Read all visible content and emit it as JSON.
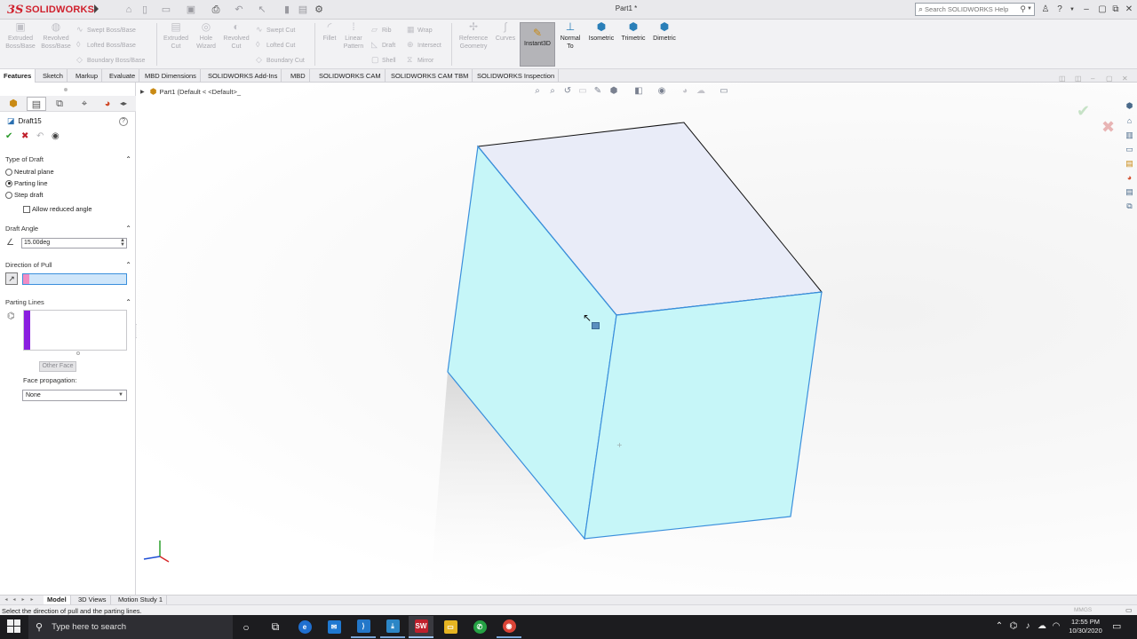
{
  "app": {
    "logo_ds": "3S",
    "logo_name": "SOLIDWORKS",
    "document_title": "Part1 *",
    "search_placeholder": "Search SOLIDWORKS Help"
  },
  "ribbon": {
    "tools_left": [
      {
        "label": "Extruded Boss/Base",
        "line1": "Extruded",
        "line2": "Boss/Base"
      },
      {
        "label": "Revolved Boss/Base",
        "line1": "Revolved",
        "line2": "Boss/Base"
      }
    ],
    "boss_small": [
      "Swept Boss/Base",
      "Lofted Boss/Base",
      "Boundary Boss/Base"
    ],
    "cut_tools": [
      {
        "line1": "Extruded",
        "line2": "Cut"
      },
      {
        "line1": "Hole",
        "line2": "Wizard"
      },
      {
        "line1": "Revolved",
        "line2": "Cut"
      }
    ],
    "cut_small": [
      "Swept Cut",
      "Lofted Cut",
      "Boundary Cut"
    ],
    "fillet": "Fillet",
    "linear_pattern": {
      "line1": "Linear",
      "line2": "Pattern"
    },
    "feature_small": [
      "Rib",
      "Draft",
      "Shell"
    ],
    "feature_small2": [
      "Wrap",
      "Intersect",
      "Mirror"
    ],
    "reference_geometry": {
      "line1": "Reference",
      "line2": "Geometry"
    },
    "curves": "Curves",
    "instant3d": "Instant3D",
    "views": [
      {
        "line1": "Normal",
        "line2": "To"
      },
      {
        "line1": "Isometric",
        "line2": ""
      },
      {
        "line1": "Trimetric",
        "line2": ""
      },
      {
        "line1": "Dimetric",
        "line2": ""
      }
    ]
  },
  "tabs": [
    "Features",
    "Sketch",
    "Markup",
    "Evaluate",
    "MBD Dimensions",
    "SOLIDWORKS Add-Ins",
    "MBD",
    "SOLIDWORKS CAM",
    "SOLIDWORKS CAM TBM",
    "SOLIDWORKS Inspection"
  ],
  "property_manager": {
    "title": "Draft15",
    "type_of_draft": {
      "heading": "Type of Draft",
      "options": [
        "Neutral plane",
        "Parting line",
        "Step draft"
      ],
      "selected": "Parting line",
      "allow_reduced": "Allow reduced angle"
    },
    "draft_angle": {
      "heading": "Draft Angle",
      "value": "15.00deg"
    },
    "direction_of_pull": {
      "heading": "Direction of Pull"
    },
    "parting_lines": {
      "heading": "Parting Lines",
      "other_face": "Other Face"
    },
    "face_propagation": {
      "label": "Face propagation:",
      "value": "None"
    }
  },
  "viewport": {
    "tree_path": "Part1  (Default < <Default>_"
  },
  "bottom_tabs": [
    "Model",
    "3D Views",
    "Motion Study 1"
  ],
  "status": {
    "message": "Select the direction of pull and the parting lines.",
    "units": "MMGS"
  },
  "taskbar": {
    "search_placeholder": "Type here to search",
    "time": "12:55 PM",
    "date": "10/30/2020"
  },
  "colors": {
    "face_side": "#c6f6f8",
    "face_top": "#e9ecf8",
    "edge_selected": "#3a8fdc",
    "logo_red": "#d0202c"
  }
}
